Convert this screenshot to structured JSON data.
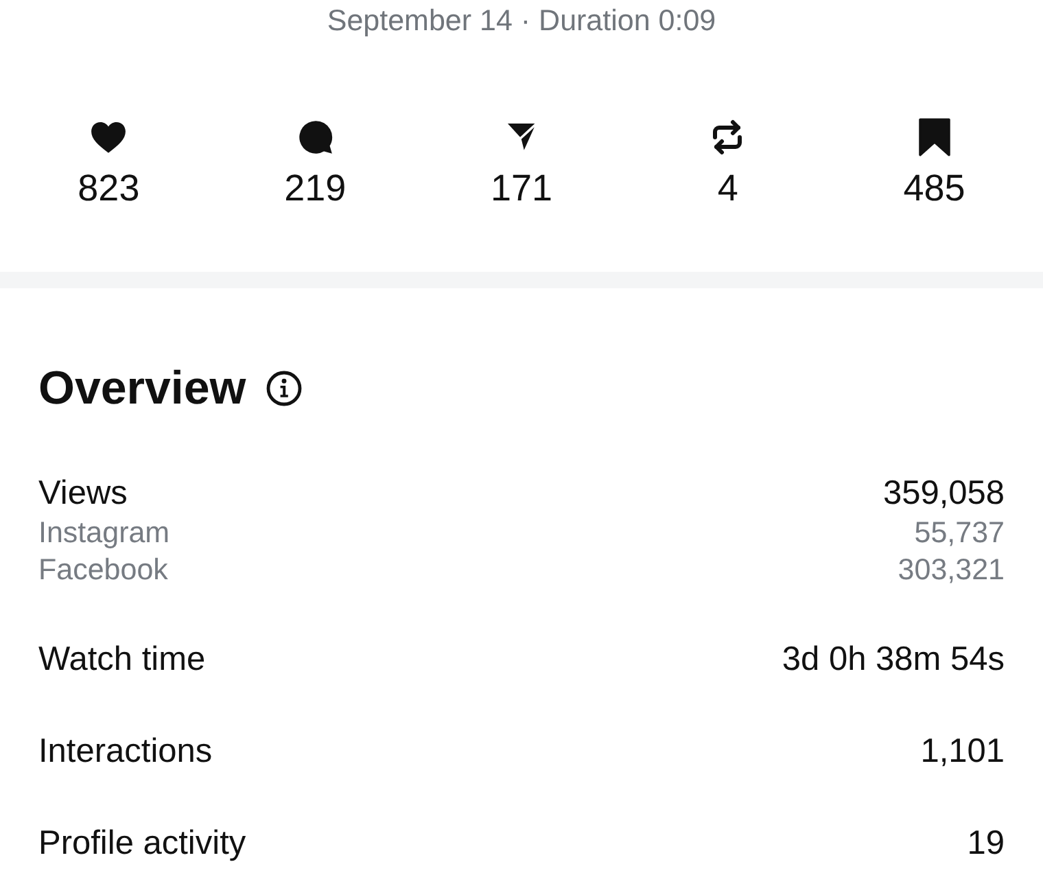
{
  "header": {
    "subtitle": "September 14 · Duration 0:09"
  },
  "stats": [
    {
      "kind": "likes",
      "value": "823"
    },
    {
      "kind": "comments",
      "value": "219"
    },
    {
      "kind": "shares",
      "value": "171"
    },
    {
      "kind": "reposts",
      "value": "4"
    },
    {
      "kind": "saves",
      "value": "485"
    }
  ],
  "overview": {
    "title": "Overview",
    "metrics": [
      {
        "label": "Views",
        "value": "359,058",
        "breakdown": [
          {
            "label": "Instagram",
            "value": "55,737"
          },
          {
            "label": "Facebook",
            "value": "303,321"
          }
        ]
      },
      {
        "label": "Watch time",
        "value": "3d 0h 38m 54s"
      },
      {
        "label": "Interactions",
        "value": "1,101"
      },
      {
        "label": "Profile activity",
        "value": "19"
      }
    ]
  }
}
